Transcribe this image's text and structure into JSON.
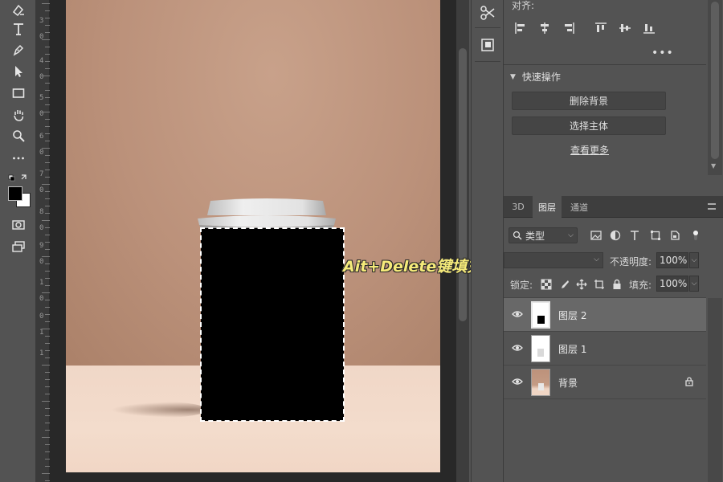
{
  "canvas": {
    "caption": "Ait+Delete键填充选框",
    "ruler_numbers": [
      "3",
      "0",
      "4",
      "0",
      "5",
      "0",
      "6",
      "0",
      "7",
      "0",
      "8",
      "0",
      "9",
      "0",
      "1",
      "0",
      "0",
      "1",
      "1"
    ]
  },
  "properties": {
    "align_label": "对齐:",
    "more_label": "•••",
    "quick_actions_title": "快速操作",
    "remove_bg_button": "删除背景",
    "select_subject_button": "选择主体",
    "see_more_link": "查看更多"
  },
  "layers_panel": {
    "tabs": [
      {
        "label": "3D",
        "active": false
      },
      {
        "label": "图层",
        "active": true
      },
      {
        "label": "通道",
        "active": false
      }
    ],
    "filter_type": "类型",
    "opacity_label": "不透明度:",
    "opacity_value": "100%",
    "lock_label": "锁定:",
    "fill_label": "填充:",
    "fill_value": "100%",
    "layers": [
      {
        "name": "图层 2",
        "selected": true,
        "visible": true,
        "locked": false
      },
      {
        "name": "图层 1",
        "selected": false,
        "visible": true,
        "locked": false
      },
      {
        "name": "背景",
        "selected": false,
        "visible": true,
        "locked": true
      }
    ]
  },
  "colors": {
    "foreground": "#000000",
    "background": "#ffffff",
    "caption": "#f5ea7a"
  }
}
